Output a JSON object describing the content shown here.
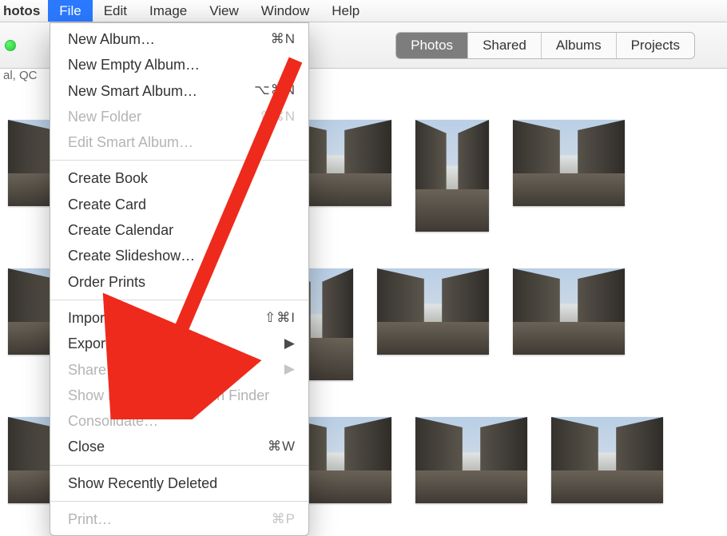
{
  "menubar": {
    "app": "hotos",
    "file": "File",
    "edit": "Edit",
    "image": "Image",
    "view": "View",
    "window": "Window",
    "help": "Help"
  },
  "toolbar": {
    "segments": {
      "photos": "Photos",
      "shared": "Shared",
      "albums": "Albums",
      "projects": "Projects"
    }
  },
  "location_suffix": "al, QC",
  "file_menu": {
    "new_album": "New Album…",
    "new_album_k": "⌘N",
    "new_empty": "New Empty Album…",
    "new_smart": "New Smart Album…",
    "new_smart_k": "⌥⌘N",
    "new_folder": "New Folder",
    "new_folder_k": "⇧⌘N",
    "edit_smart": "Edit Smart Album…",
    "create_book": "Create Book",
    "create_card": "Create Card",
    "create_cal": "Create Calendar",
    "create_slide": "Create Slideshow…",
    "order_prints": "Order Prints",
    "import": "Import…",
    "import_k": "⇧⌘I",
    "export": "Export",
    "export_sub": "▶",
    "share": "Share",
    "share_sub": "▶",
    "show_ref": "Show Referenced File in Finder",
    "consolidate": "Consolidate…",
    "close": "Close",
    "close_k": "⌘W",
    "show_deleted": "Show Recently Deleted",
    "print": "Print…",
    "print_k": "⌘P"
  },
  "annotation": {
    "arrow_color": "#EE2A1C"
  }
}
